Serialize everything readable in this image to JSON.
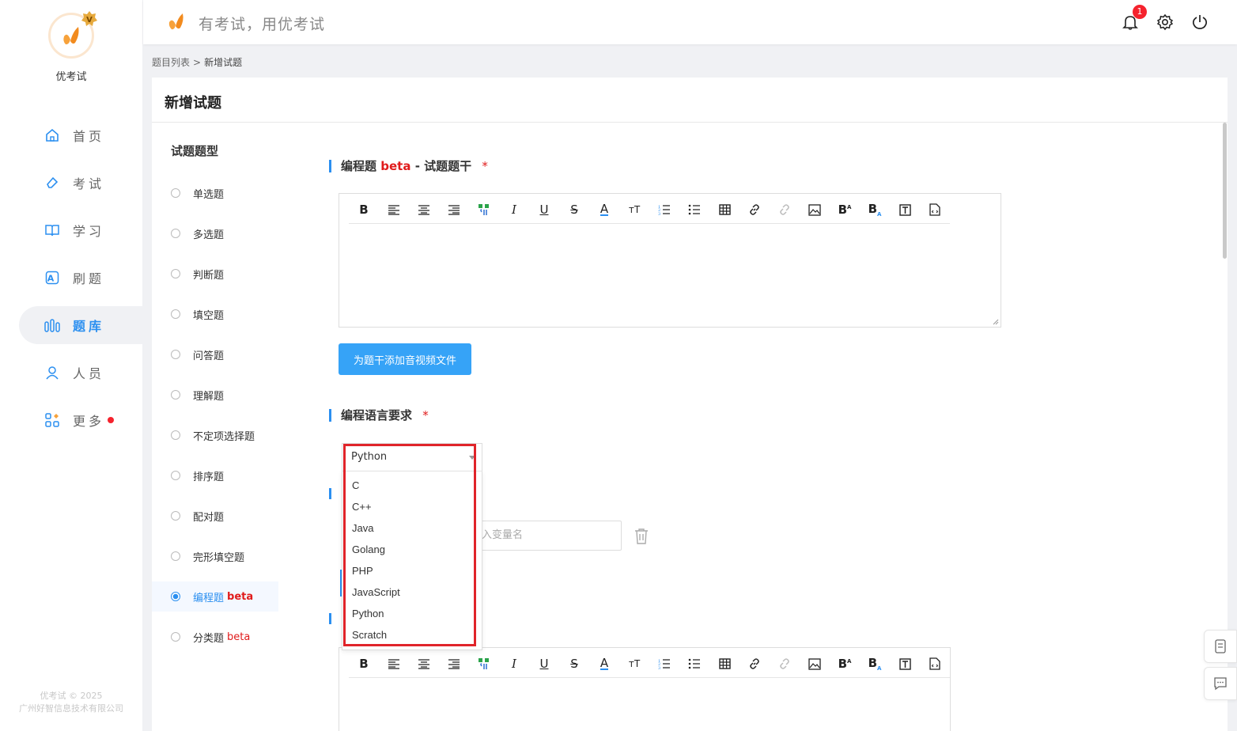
{
  "app": {
    "name": "优考试",
    "copyright_line1": "优考试 © 2025",
    "copyright_line2": "广州好智信息技术有限公司"
  },
  "topbar": {
    "slogan": "有考试，用优考试",
    "notification_count": "1"
  },
  "nav": [
    {
      "label": "首页",
      "icon": "home-icon"
    },
    {
      "label": "考试",
      "icon": "eraser-icon"
    },
    {
      "label": "学习",
      "icon": "book-icon"
    },
    {
      "label": "刷题",
      "icon": "practice-icon"
    },
    {
      "label": "题库",
      "icon": "bank-icon",
      "active": true
    },
    {
      "label": "人员",
      "icon": "user-icon"
    },
    {
      "label": "更多",
      "icon": "apps-icon",
      "has_dot": true
    }
  ],
  "breadcrumb": {
    "parent": "题目列表",
    "separator": ">",
    "current": "新增试题"
  },
  "page": {
    "title": "新增试题"
  },
  "question_types": {
    "heading": "试题题型",
    "items": [
      {
        "label": "单选题"
      },
      {
        "label": "多选题"
      },
      {
        "label": "判断题"
      },
      {
        "label": "填空题"
      },
      {
        "label": "问答题"
      },
      {
        "label": "理解题"
      },
      {
        "label": "不定项选择题"
      },
      {
        "label": "排序题"
      },
      {
        "label": "配对题"
      },
      {
        "label": "完形填空题"
      },
      {
        "label": "编程题",
        "beta": "beta",
        "selected": true
      },
      {
        "label": "分类题",
        "beta": "beta"
      }
    ]
  },
  "stem_section": {
    "title_prefix": "编程题",
    "title_beta": "beta",
    "title_suffix": "- 试题题干",
    "required": "*"
  },
  "toolbar_icons": [
    "bold",
    "align-left",
    "align-center",
    "align-right",
    "format-painter",
    "italic",
    "underline",
    "strikethrough",
    "font-color",
    "font-size",
    "ordered-list",
    "unordered-list",
    "table",
    "link",
    "unlink",
    "image",
    "superscript",
    "subscript",
    "text-box",
    "code-file"
  ],
  "media_button": {
    "label": "为题干添加音视频文件"
  },
  "language_section": {
    "title": "编程语言要求",
    "required": "*"
  },
  "language_select": {
    "value": "Python",
    "options": [
      "C",
      "C++",
      "Java",
      "Golang",
      "PHP",
      "JavaScript",
      "Python",
      "Scratch"
    ]
  },
  "variable_input": {
    "placeholder": "入变量名"
  }
}
